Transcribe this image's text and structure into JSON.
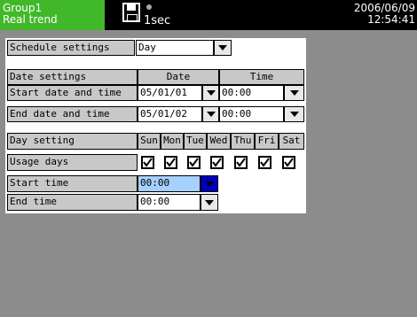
{
  "header": {
    "group": "Group1",
    "mode": "Real trend",
    "interval": "1sec",
    "date": "2006/06/09",
    "time": "12:54:41"
  },
  "schedule": {
    "label": "Schedule settings",
    "value": "Day"
  },
  "date_settings": {
    "label": "Date settings",
    "date_header": "Date",
    "time_header": "Time",
    "rows": [
      {
        "label": "Start date and time",
        "date": "05/01/01",
        "time": "00:00"
      },
      {
        "label": "End date and time",
        "date": "05/01/02",
        "time": "00:00"
      }
    ]
  },
  "day_setting": {
    "label": "Day setting",
    "days": [
      "Sun",
      "Mon",
      "Tue",
      "Wed",
      "Thu",
      "Fri",
      "Sat"
    ],
    "usage_label": "Usage days",
    "usage_checked": [
      true,
      true,
      true,
      true,
      true,
      true,
      true
    ],
    "start_label": "Start time",
    "start_value": "00:00",
    "end_label": "End time",
    "end_value": "00:00"
  },
  "colors": {
    "header_green": "#41b82a",
    "highlight": "#a6d0ff",
    "active_button": "#0000c0",
    "background": "#8c8c8c"
  },
  "icons": {
    "disk": "floppy-disk-icon",
    "status": "status-dot-icon",
    "dropdown": "chevron-down-icon",
    "check": "checkmark-icon"
  }
}
